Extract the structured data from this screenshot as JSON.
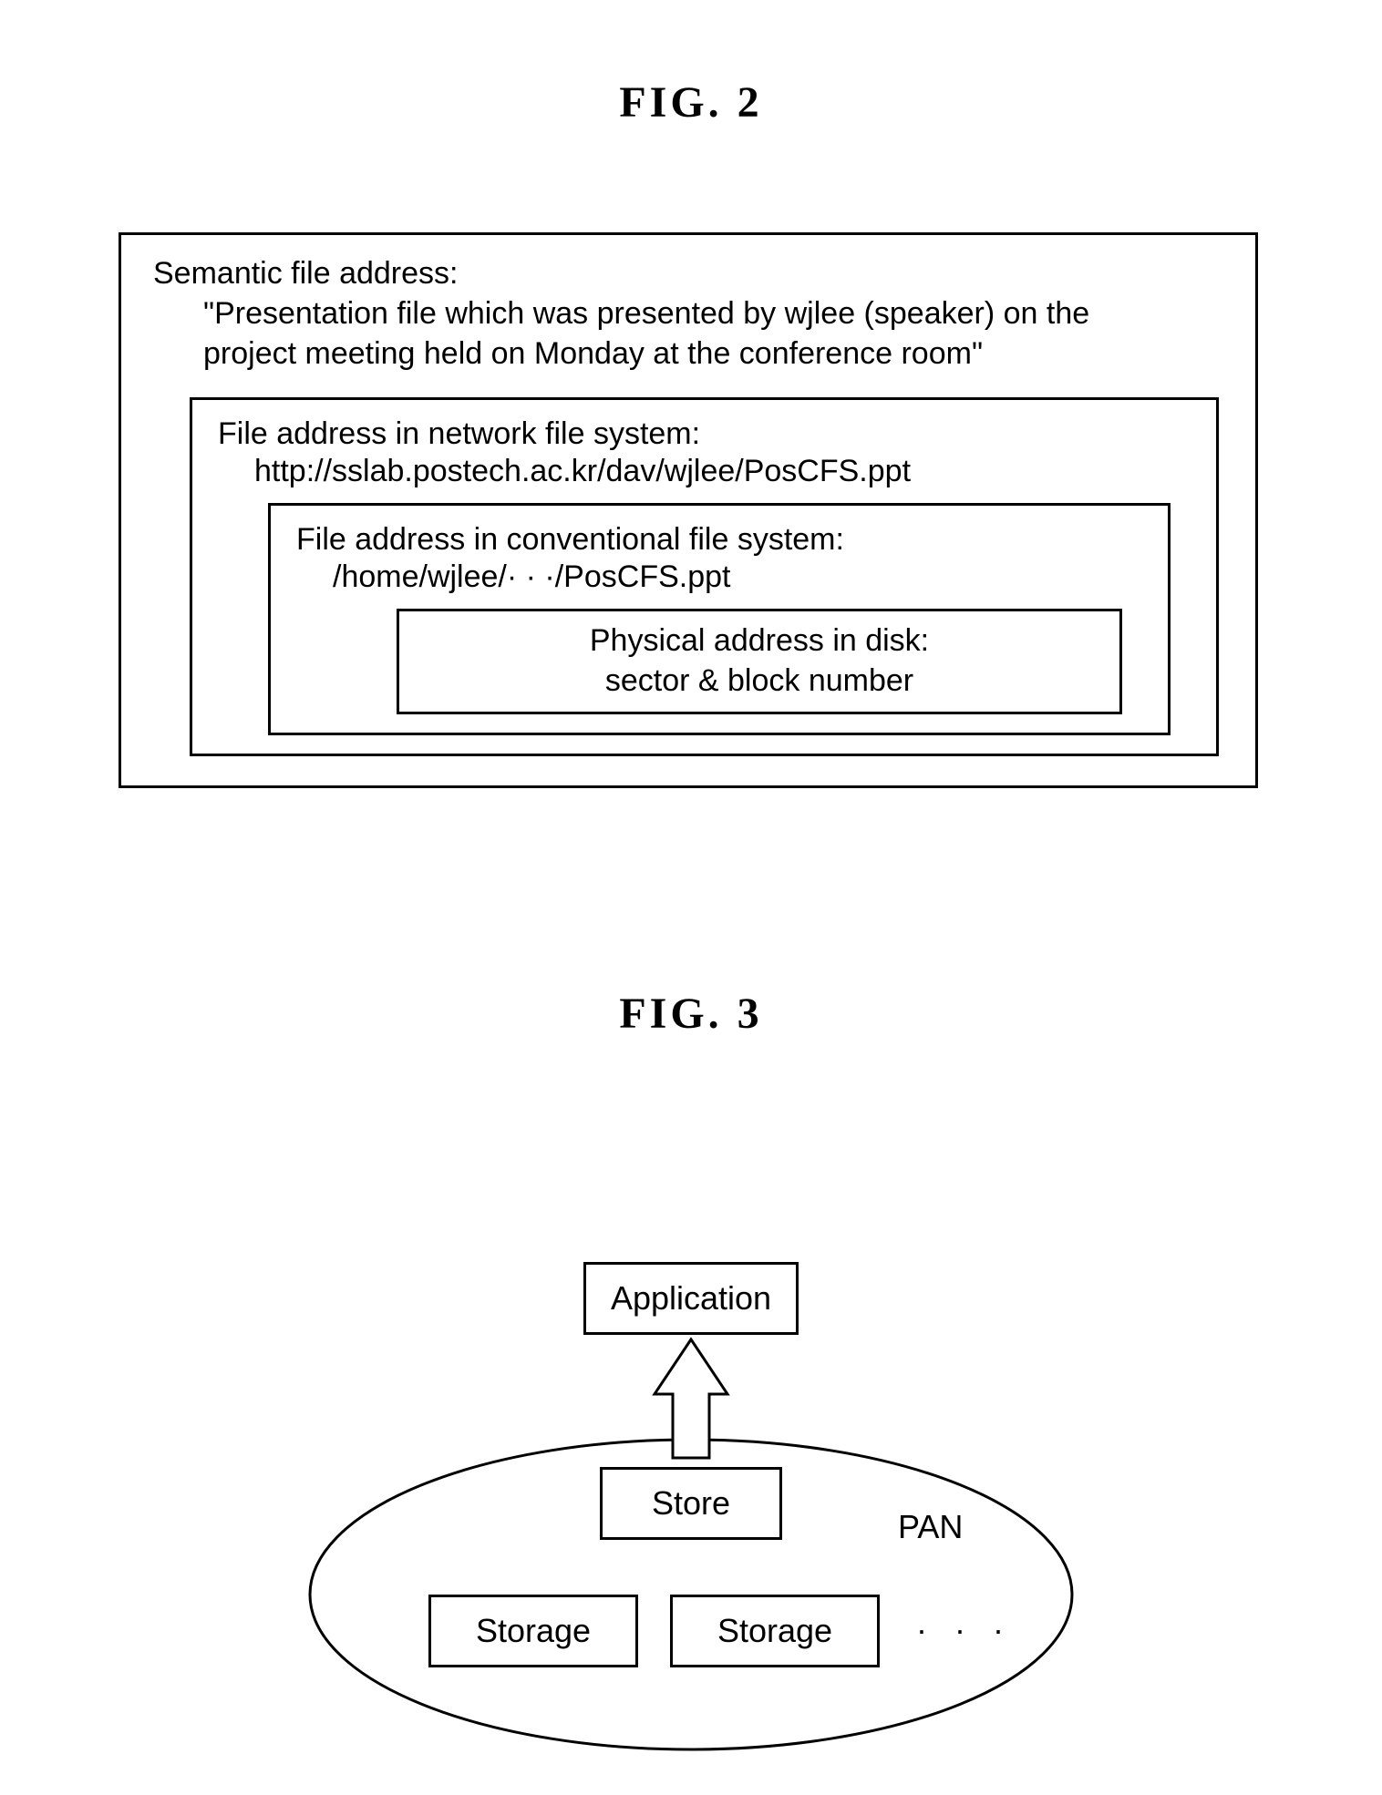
{
  "fig2": {
    "title": "FIG. 2",
    "semantic_label": "Semantic file address:",
    "semantic_text_l1": "\"Presentation file which was presented by wjlee (speaker) on the",
    "semantic_text_l2": "project meeting held on Monday at the conference room\"",
    "net_label": "File address in network file system:",
    "net_value": "http://sslab.postech.ac.kr/dav/wjlee/PosCFS.ppt",
    "conv_label": "File address in conventional file system:",
    "conv_value": "/home/wjlee/· · ·/PosCFS.ppt",
    "phys_label": "Physical address in disk:",
    "phys_value": "sector & block number"
  },
  "fig3": {
    "title": "FIG. 3",
    "app": "Application",
    "store": "Store",
    "storage1": "Storage",
    "storage2": "Storage",
    "dots": "· · ·",
    "pan": "PAN"
  }
}
